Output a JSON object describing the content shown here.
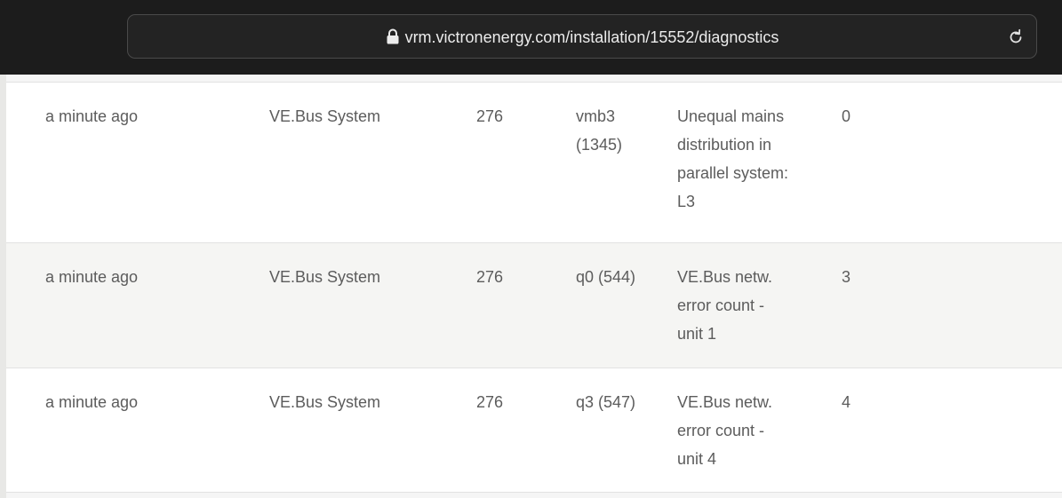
{
  "browser": {
    "url": "vrm.victronenergy.com/installation/15552/diagnostics"
  },
  "icons": {
    "lock": "lock-icon",
    "reload": "reload-icon"
  },
  "rows": [
    {
      "time": "a minute ago",
      "device": "VE.Bus System",
      "instance": "276",
      "code": "vmb3\n(1345)",
      "description": "Unequal mains\ndistribution in\nparallel system:\nL3",
      "value": "0"
    },
    {
      "time": "a minute ago",
      "device": "VE.Bus System",
      "instance": "276",
      "code": "q0 (544)",
      "description": "VE.Bus netw.\nerror count -\nunit 1",
      "value": "3"
    },
    {
      "time": "a minute ago",
      "device": "VE.Bus System",
      "instance": "276",
      "code": "q3 (547)",
      "description": "VE.Bus netw.\nerror count -\nunit 4",
      "value": "4"
    }
  ]
}
